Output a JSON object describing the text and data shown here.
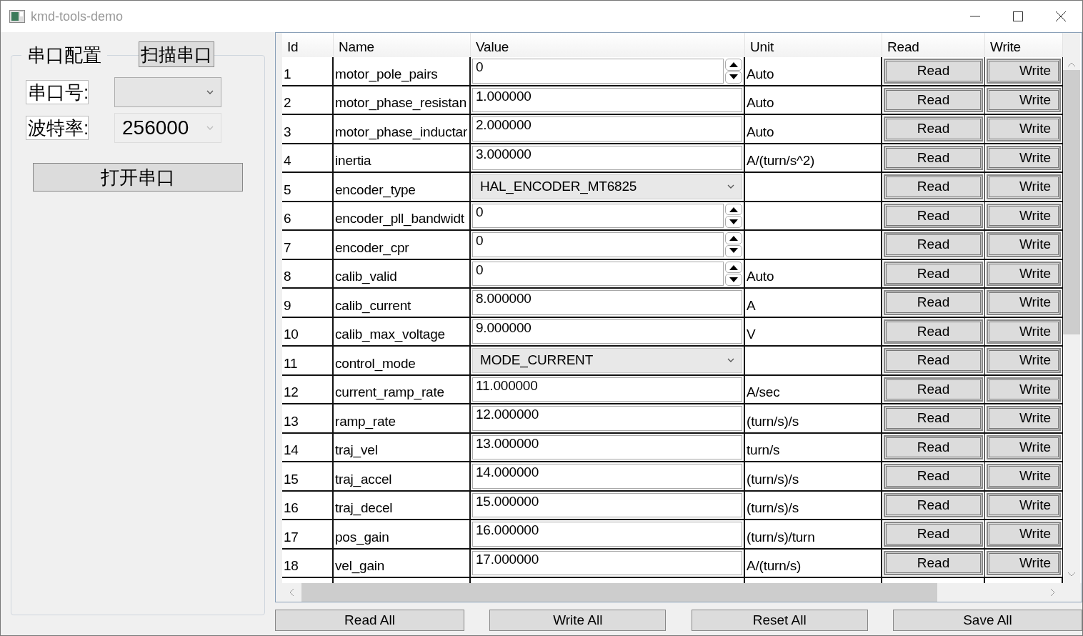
{
  "window": {
    "title": "kmd-tools-demo"
  },
  "serial": {
    "group_title": "串口配置",
    "scan_button": "扫描串口",
    "port_label": "串口号:",
    "baud_label": "波特率:",
    "baud_value": "256000",
    "open_button": "打开串口"
  },
  "table": {
    "columns": [
      "Id",
      "Name",
      "Value",
      "Unit",
      "Read",
      "Write"
    ],
    "rows": [
      {
        "id": "1",
        "name": "motor_pole_pairs",
        "kind": "spin",
        "value": "0",
        "unit": "Auto",
        "read": "Read",
        "write": "Write"
      },
      {
        "id": "2",
        "name": "motor_phase_resistan",
        "kind": "text",
        "value": "1.000000",
        "unit": "Auto",
        "read": "Read",
        "write": "Write"
      },
      {
        "id": "3",
        "name": "motor_phase_inductar",
        "kind": "text",
        "value": "2.000000",
        "unit": "Auto",
        "read": "Read",
        "write": "Write"
      },
      {
        "id": "4",
        "name": "inertia",
        "kind": "text",
        "value": "3.000000",
        "unit": "A/(turn/s^2)",
        "read": "Read",
        "write": "Write"
      },
      {
        "id": "5",
        "name": "encoder_type",
        "kind": "combo",
        "value": "HAL_ENCODER_MT6825",
        "unit": "",
        "read": "Read",
        "write": "Write"
      },
      {
        "id": "6",
        "name": "encoder_pll_bandwidt",
        "kind": "spin",
        "value": "0",
        "unit": "",
        "read": "Read",
        "write": "Write"
      },
      {
        "id": "7",
        "name": "encoder_cpr",
        "kind": "spin",
        "value": "0",
        "unit": "",
        "read": "Read",
        "write": "Write"
      },
      {
        "id": "8",
        "name": "calib_valid",
        "kind": "spin",
        "value": "0",
        "unit": "Auto",
        "read": "Read",
        "write": "Write"
      },
      {
        "id": "9",
        "name": "calib_current",
        "kind": "text",
        "value": "8.000000",
        "unit": "A",
        "read": "Read",
        "write": "Write"
      },
      {
        "id": "10",
        "name": "calib_max_voltage",
        "kind": "text",
        "value": "9.000000",
        "unit": "V",
        "read": "Read",
        "write": "Write"
      },
      {
        "id": "11",
        "name": "control_mode",
        "kind": "combo",
        "value": "MODE_CURRENT",
        "unit": "",
        "read": "Read",
        "write": "Write"
      },
      {
        "id": "12",
        "name": "current_ramp_rate",
        "kind": "text",
        "value": "11.000000",
        "unit": "A/sec",
        "read": "Read",
        "write": "Write"
      },
      {
        "id": "13",
        "name": "ramp_rate",
        "kind": "text",
        "value": "12.000000",
        "unit": "(turn/s)/s",
        "read": "Read",
        "write": "Write"
      },
      {
        "id": "14",
        "name": "traj_vel",
        "kind": "text",
        "value": "13.000000",
        "unit": "turn/s",
        "read": "Read",
        "write": "Write"
      },
      {
        "id": "15",
        "name": "traj_accel",
        "kind": "text",
        "value": "14.000000",
        "unit": "(turn/s)/s",
        "read": "Read",
        "write": "Write"
      },
      {
        "id": "16",
        "name": "traj_decel",
        "kind": "text",
        "value": "15.000000",
        "unit": "(turn/s)/s",
        "read": "Read",
        "write": "Write"
      },
      {
        "id": "17",
        "name": "pos_gain",
        "kind": "text",
        "value": "16.000000",
        "unit": "(turn/s)/turn",
        "read": "Read",
        "write": "Write"
      },
      {
        "id": "18",
        "name": "vel_gain",
        "kind": "text",
        "value": "17.000000",
        "unit": "A/(turn/s)",
        "read": "Read",
        "write": "Write"
      }
    ]
  },
  "actions": [
    "Read All",
    "Write All",
    "Reset All",
    "Save All"
  ]
}
